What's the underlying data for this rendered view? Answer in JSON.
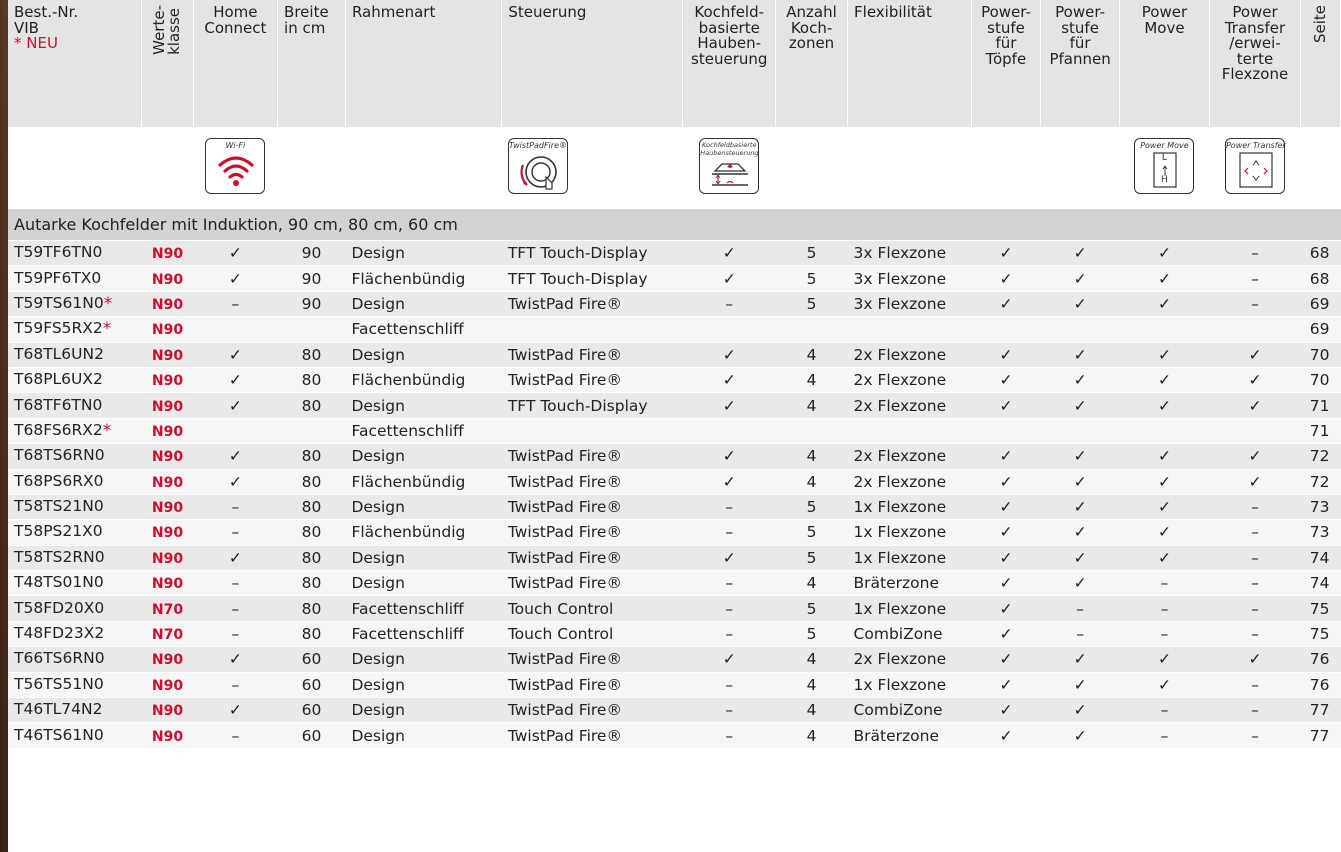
{
  "headers": {
    "best_nr": [
      "Best.-Nr.",
      "VIB"
    ],
    "neu": "* NEU",
    "werteklasse": [
      "Werte-",
      "klasse"
    ],
    "home_connect": [
      "Home",
      "Connect"
    ],
    "breite": [
      "Breite",
      "in cm"
    ],
    "rahmenart": "Rahmenart",
    "steuerung": "Steuerung",
    "kochfeld": [
      "Kochfeld-",
      "basierte",
      "Hauben-",
      "steuerung"
    ],
    "anzahl": [
      "Anzahl",
      "Koch-",
      "zonen"
    ],
    "flex": "Flexibilität",
    "ps_toepfe": [
      "Power-",
      "stufe",
      "für",
      "Töpfe"
    ],
    "ps_pfannen": [
      "Power-",
      "stufe",
      "für",
      "Pfannen"
    ],
    "power_move": [
      "Power",
      "Move"
    ],
    "power_transfer": [
      "Power",
      "Transfer",
      "/erwei-",
      "terte",
      "Flexzone"
    ],
    "seite": "Seite"
  },
  "icons": {
    "wifi": "Wi-Fi",
    "twistpad": "TwistPadFire®",
    "kochfeld": [
      "Kochfeldbasierte",
      "Haubensteuerung"
    ],
    "power_move": "Power Move",
    "power_move_letters": [
      "L",
      "H"
    ],
    "power_transfer": "Power Transfer"
  },
  "section_title": "Autarke Kochfelder mit Induktion, 90 cm, 80 cm, 60 cm",
  "rows": [
    {
      "nr": "T59TF6TN0",
      "neu": "",
      "cls": "N90",
      "hc": "✓",
      "breite": "90",
      "rahmen": "Design",
      "steuerung": "TFT Touch-Display",
      "kochfeld": "✓",
      "anzahl": "5",
      "flex": "3x Flexzone",
      "ps_t": "✓",
      "ps_p": "✓",
      "pm": "✓",
      "pt": "–",
      "seite": "68"
    },
    {
      "nr": "T59PF6TX0",
      "neu": "",
      "cls": "N90",
      "hc": "✓",
      "breite": "90",
      "rahmen": "Flächenbündig",
      "steuerung": "TFT Touch-Display",
      "kochfeld": "✓",
      "anzahl": "5",
      "flex": "3x Flexzone",
      "ps_t": "✓",
      "ps_p": "✓",
      "pm": "✓",
      "pt": "–",
      "seite": "68"
    },
    {
      "nr": "T59TS61N0",
      "neu": "*",
      "cls": "N90",
      "hc": "–",
      "breite": "90",
      "rahmen": "Design",
      "steuerung": "TwistPad Fire®",
      "kochfeld": "–",
      "anzahl": "5",
      "flex": "3x Flexzone",
      "ps_t": "✓",
      "ps_p": "✓",
      "pm": "✓",
      "pt": "–",
      "seite": "69"
    },
    {
      "nr": "T59FS5RX2",
      "neu": "*",
      "cls": "N90",
      "hc": "",
      "breite": "",
      "rahmen": "Facettenschliff",
      "steuerung": "",
      "kochfeld": "",
      "anzahl": "",
      "flex": "",
      "ps_t": "",
      "ps_p": "",
      "pm": "",
      "pt": "",
      "seite": "69"
    },
    {
      "nr": "T68TL6UN2",
      "neu": "",
      "cls": "N90",
      "hc": "✓",
      "breite": "80",
      "rahmen": "Design",
      "steuerung": "TwistPad Fire®",
      "kochfeld": "✓",
      "anzahl": "4",
      "flex": "2x Flexzone",
      "ps_t": "✓",
      "ps_p": "✓",
      "pm": "✓",
      "pt": "✓",
      "seite": "70"
    },
    {
      "nr": "T68PL6UX2",
      "neu": "",
      "cls": "N90",
      "hc": "✓",
      "breite": "80",
      "rahmen": "Flächenbündig",
      "steuerung": "TwistPad Fire®",
      "kochfeld": "✓",
      "anzahl": "4",
      "flex": "2x Flexzone",
      "ps_t": "✓",
      "ps_p": "✓",
      "pm": "✓",
      "pt": "✓",
      "seite": "70"
    },
    {
      "nr": "T68TF6TN0",
      "neu": "",
      "cls": "N90",
      "hc": "✓",
      "breite": "80",
      "rahmen": "Design",
      "steuerung": "TFT Touch-Display",
      "kochfeld": "✓",
      "anzahl": "4",
      "flex": "2x Flexzone",
      "ps_t": "✓",
      "ps_p": "✓",
      "pm": "✓",
      "pt": "✓",
      "seite": "71"
    },
    {
      "nr": "T68FS6RX2",
      "neu": "*",
      "cls": "N90",
      "hc": "",
      "breite": "",
      "rahmen": "Facettenschliff",
      "steuerung": "",
      "kochfeld": "",
      "anzahl": "",
      "flex": "",
      "ps_t": "",
      "ps_p": "",
      "pm": "",
      "pt": "",
      "seite": "71"
    },
    {
      "nr": "T68TS6RN0",
      "neu": "",
      "cls": "N90",
      "hc": "✓",
      "breite": "80",
      "rahmen": "Design",
      "steuerung": "TwistPad Fire®",
      "kochfeld": "✓",
      "anzahl": "4",
      "flex": "2x Flexzone",
      "ps_t": "✓",
      "ps_p": "✓",
      "pm": "✓",
      "pt": "✓",
      "seite": "72"
    },
    {
      "nr": "T68PS6RX0",
      "neu": "",
      "cls": "N90",
      "hc": "✓",
      "breite": "80",
      "rahmen": "Flächenbündig",
      "steuerung": "TwistPad Fire®",
      "kochfeld": "✓",
      "anzahl": "4",
      "flex": "2x Flexzone",
      "ps_t": "✓",
      "ps_p": "✓",
      "pm": "✓",
      "pt": "✓",
      "seite": "72"
    },
    {
      "nr": "T58TS21N0",
      "neu": "",
      "cls": "N90",
      "hc": "–",
      "breite": "80",
      "rahmen": "Design",
      "steuerung": "TwistPad Fire®",
      "kochfeld": "–",
      "anzahl": "5",
      "flex": "1x Flexzone",
      "ps_t": "✓",
      "ps_p": "✓",
      "pm": "✓",
      "pt": "–",
      "seite": "73"
    },
    {
      "nr": "T58PS21X0",
      "neu": "",
      "cls": "N90",
      "hc": "–",
      "breite": "80",
      "rahmen": "Flächenbündig",
      "steuerung": "TwistPad Fire®",
      "kochfeld": "–",
      "anzahl": "5",
      "flex": "1x Flexzone",
      "ps_t": "✓",
      "ps_p": "✓",
      "pm": "✓",
      "pt": "–",
      "seite": "73"
    },
    {
      "nr": "T58TS2RN0",
      "neu": "",
      "cls": "N90",
      "hc": "✓",
      "breite": "80",
      "rahmen": "Design",
      "steuerung": "TwistPad Fire®",
      "kochfeld": "✓",
      "anzahl": "5",
      "flex": "1x Flexzone",
      "ps_t": "✓",
      "ps_p": "✓",
      "pm": "✓",
      "pt": "–",
      "seite": "74"
    },
    {
      "nr": "T48TS01N0",
      "neu": "",
      "cls": "N90",
      "hc": "–",
      "breite": "80",
      "rahmen": "Design",
      "steuerung": "TwistPad Fire®",
      "kochfeld": "–",
      "anzahl": "4",
      "flex": "Bräterzone",
      "ps_t": "✓",
      "ps_p": "✓",
      "pm": "–",
      "pt": "–",
      "seite": "74"
    },
    {
      "nr": "T58FD20X0",
      "neu": "",
      "cls": "N70",
      "hc": "–",
      "breite": "80",
      "rahmen": "Facettenschliff",
      "steuerung": "Touch Control",
      "kochfeld": "–",
      "anzahl": "5",
      "flex": "1x Flexzone",
      "ps_t": "✓",
      "ps_p": "–",
      "pm": "–",
      "pt": "–",
      "seite": "75"
    },
    {
      "nr": "T48FD23X2",
      "neu": "",
      "cls": "N70",
      "hc": "–",
      "breite": "80",
      "rahmen": "Facettenschliff",
      "steuerung": "Touch Control",
      "kochfeld": "–",
      "anzahl": "5",
      "flex": "CombiZone",
      "ps_t": "✓",
      "ps_p": "–",
      "pm": "–",
      "pt": "–",
      "seite": "75"
    },
    {
      "nr": "T66TS6RN0",
      "neu": "",
      "cls": "N90",
      "hc": "✓",
      "breite": "60",
      "rahmen": "Design",
      "steuerung": "TwistPad Fire®",
      "kochfeld": "✓",
      "anzahl": "4",
      "flex": "2x Flexzone",
      "ps_t": "✓",
      "ps_p": "✓",
      "pm": "✓",
      "pt": "✓",
      "seite": "76"
    },
    {
      "nr": "T56TS51N0",
      "neu": "",
      "cls": "N90",
      "hc": "–",
      "breite": "60",
      "rahmen": "Design",
      "steuerung": "TwistPad Fire®",
      "kochfeld": "–",
      "anzahl": "4",
      "flex": "1x Flexzone",
      "ps_t": "✓",
      "ps_p": "✓",
      "pm": "✓",
      "pt": "–",
      "seite": "76"
    },
    {
      "nr": "T46TL74N2",
      "neu": "",
      "cls": "N90",
      "hc": "✓",
      "breite": "60",
      "rahmen": "Design",
      "steuerung": "TwistPad Fire®",
      "kochfeld": "–",
      "anzahl": "4",
      "flex": "CombiZone",
      "ps_t": "✓",
      "ps_p": "✓",
      "pm": "–",
      "pt": "–",
      "seite": "77"
    },
    {
      "nr": "T46TS61N0",
      "neu": "",
      "cls": "N90",
      "hc": "–",
      "breite": "60",
      "rahmen": "Design",
      "steuerung": "TwistPad Fire®",
      "kochfeld": "–",
      "anzahl": "4",
      "flex": "Bräterzone",
      "ps_t": "✓",
      "ps_p": "✓",
      "pm": "–",
      "pt": "–",
      "seite": "77"
    }
  ]
}
